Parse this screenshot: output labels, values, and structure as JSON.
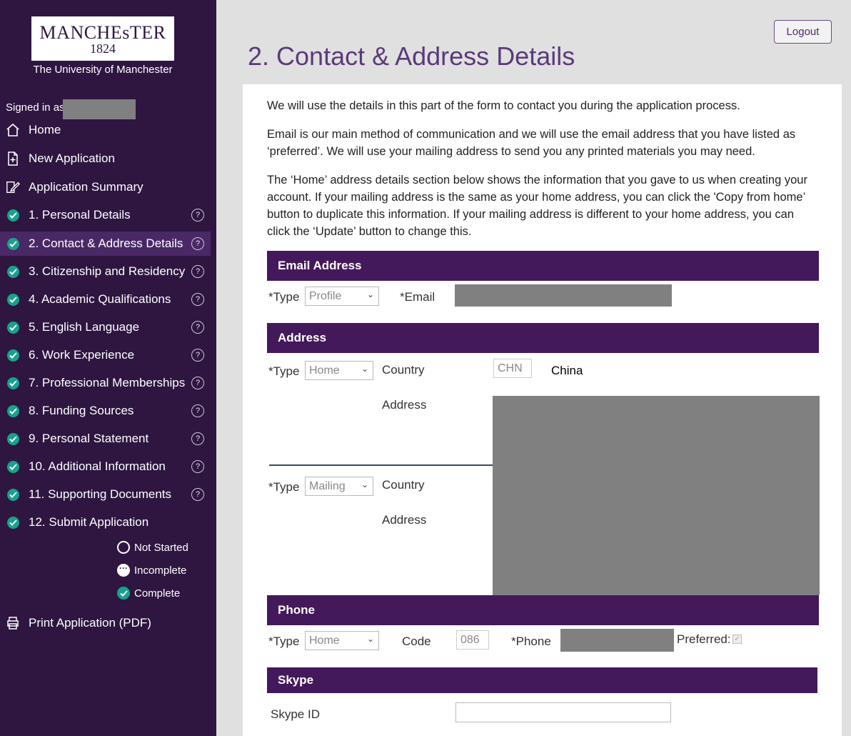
{
  "logo": {
    "line1": "MANCHEsTER",
    "line2": "1824",
    "subtitle": "The University of Manchester"
  },
  "signed_in_label": "Signed in as",
  "nav": {
    "home": "Home",
    "new_application": "New Application",
    "application_summary": "Application Summary",
    "sections": [
      "1. Personal Details",
      "2. Contact & Address Details",
      "3. Citizenship and Residency",
      "4. Academic Qualifications",
      "5. English Language",
      "6. Work Experience",
      "7. Professional Memberships",
      "8. Funding Sources",
      "9. Personal Statement",
      "10. Additional Information",
      "11. Supporting Documents",
      "12. Submit Application"
    ],
    "help_glyph": "?",
    "print": "Print Application (PDF)"
  },
  "legend": {
    "not_started": "Not Started",
    "incomplete": "Incomplete",
    "complete": "Complete",
    "dots_glyph": "···"
  },
  "logout": "Logout",
  "page_title": "2. Contact & Address Details",
  "intro": {
    "p1": "We will use the details in this part of the form to contact you during the application process.",
    "p2": "Email is our main method of communication and we will use the email address that you have listed as ‘preferred’. We will use your mailing address to send you any printed materials you may need.",
    "p3": "The ‘Home’ address details section below shows the information that you gave to us when creating your account. If your mailing address is the same as your home address, you can click the 'Copy from home’ button to duplicate this information. If your mailing address is different to your home address, you can click the ‘Update’ button to change this."
  },
  "email": {
    "heading": "Email Address",
    "type_label": "*Type",
    "type_value": "Profile",
    "email_label": "*Email"
  },
  "address": {
    "heading": "Address",
    "type_label": "*Type",
    "home_type": "Home",
    "country_label": "Country",
    "country_code": "CHN",
    "country_name": "China",
    "address_label": "Address",
    "mailing_type": "Mailing"
  },
  "phone": {
    "heading": "Phone",
    "type_label": "*Type",
    "type_value": "Home",
    "code_label": "Code",
    "code_value": "086",
    "phone_label": "*Phone",
    "preferred_label": "Preferred:",
    "check_glyph": "✓"
  },
  "skype": {
    "heading": "Skype",
    "id_label": "Skype ID"
  },
  "chevron_glyph": "⌄",
  "colors": {
    "sidebar": "#2e1641",
    "band": "#43195b",
    "check": "#17a28c",
    "title": "#5a3a7a"
  }
}
